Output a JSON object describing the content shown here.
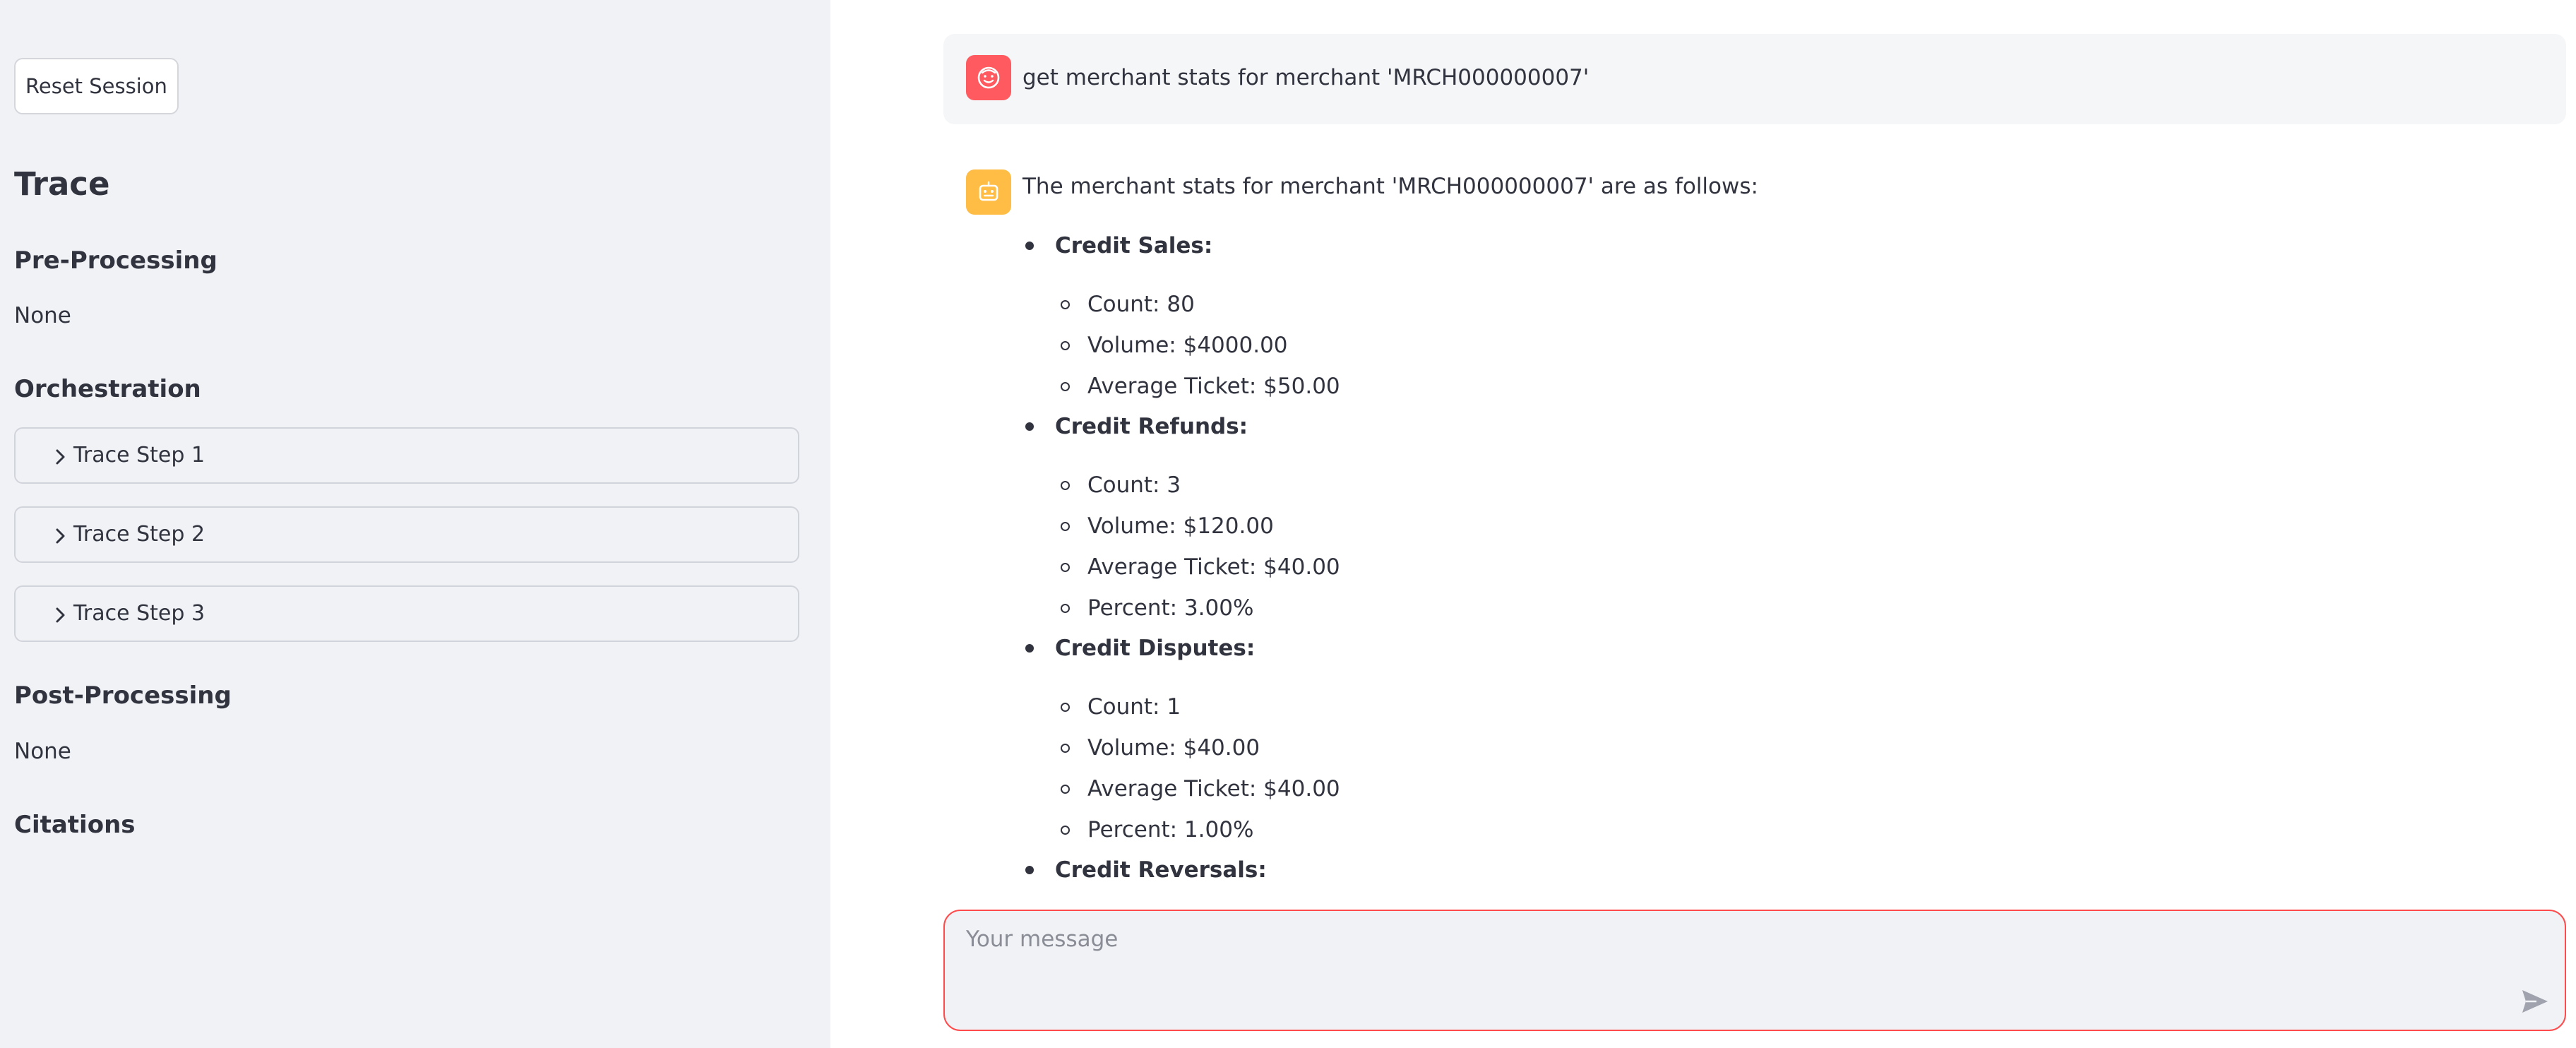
{
  "sidebar": {
    "reset_label": "Reset Session",
    "trace_heading": "Trace",
    "pre_processing_heading": "Pre-Processing",
    "pre_processing_value": "None",
    "orchestration_heading": "Orchestration",
    "trace_steps": [
      {
        "label": "Trace Step 1"
      },
      {
        "label": "Trace Step 2"
      },
      {
        "label": "Trace Step 3"
      }
    ],
    "post_processing_heading": "Post-Processing",
    "post_processing_value": "None",
    "citations_heading": "Citations"
  },
  "chat": {
    "user_message": "get merchant stats for merchant 'MRCH000000007'",
    "assistant_intro": "The merchant stats for merchant 'MRCH000000007' are as follows:",
    "sections": [
      {
        "title": "Credit Sales:",
        "items": [
          "Count: 80",
          "Volume: $4000.00",
          "Average Ticket: $50.00"
        ]
      },
      {
        "title": "Credit Refunds:",
        "items": [
          "Count: 3",
          "Volume: $120.00",
          "Average Ticket: $40.00",
          "Percent: 3.00%"
        ]
      },
      {
        "title": "Credit Disputes:",
        "items": [
          "Count: 1",
          "Volume: $40.00",
          "Average Ticket: $40.00",
          "Percent: 1.00%"
        ]
      },
      {
        "title": "Credit Reversals:",
        "items": []
      }
    ],
    "input_placeholder": "Your message"
  },
  "icons": {
    "chevron": "chevron-right-icon",
    "user_avatar": "user-face-icon",
    "assistant_avatar": "robot-icon",
    "send": "send-icon"
  },
  "colors": {
    "sidebar_bg": "#f0f2f6",
    "user_avatar": "#ff5a5f",
    "assistant_avatar": "#ffbd45",
    "input_border": "#ff4b4b"
  }
}
